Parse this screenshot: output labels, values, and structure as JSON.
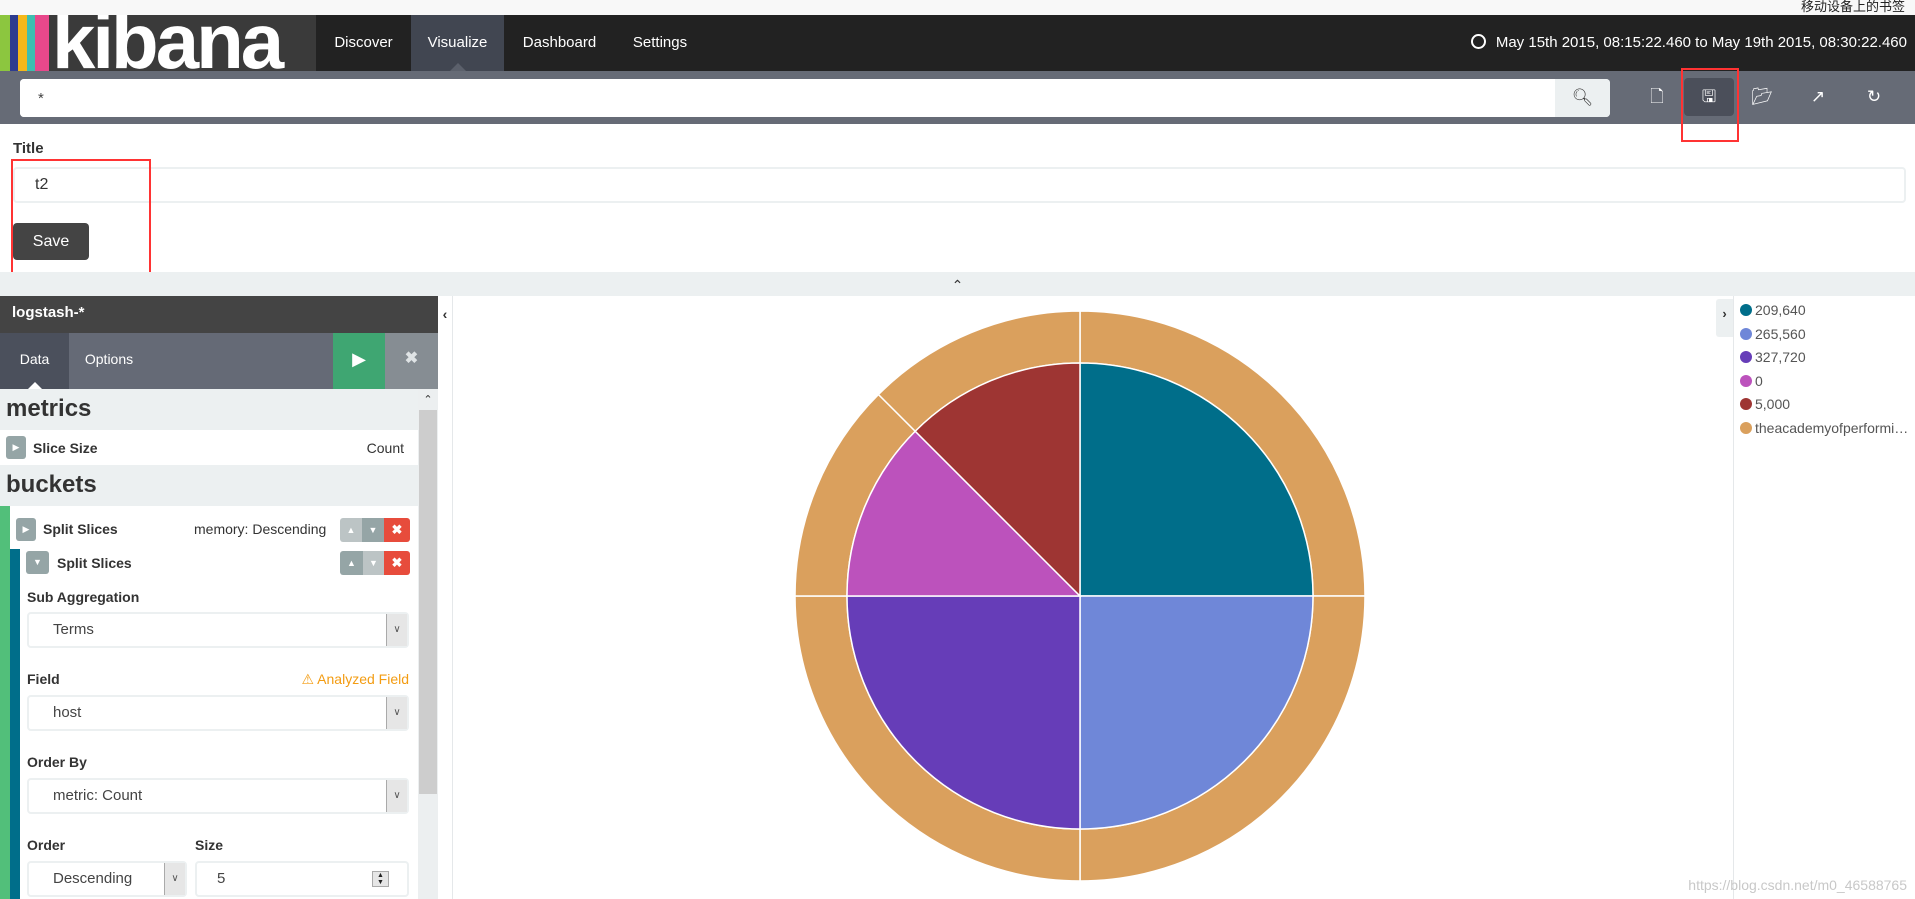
{
  "browser": {
    "bookmark_label": "移动设备上的书签"
  },
  "nav": {
    "logo": "kibana",
    "items": [
      {
        "label": "Discover"
      },
      {
        "label": "Visualize",
        "active": true
      },
      {
        "label": "Dashboard"
      },
      {
        "label": "Settings"
      }
    ],
    "time_range": "May 15th 2015, 08:15:22.460 to May 19th 2015, 08:30:22.460"
  },
  "search": {
    "query": "*"
  },
  "toolbar": {
    "icons": [
      "new-visualization-icon",
      "save-icon",
      "open-icon",
      "share-icon",
      "refresh-icon"
    ],
    "active": "save-icon"
  },
  "save_form": {
    "title_label": "Title",
    "title_value": "t2",
    "save_label": "Save"
  },
  "sidebar": {
    "index_pattern": "logstash-*",
    "tabs": [
      {
        "label": "Data",
        "active": true
      },
      {
        "label": "Options"
      }
    ],
    "metrics_heading": "metrics",
    "metric": {
      "label": "Slice Size",
      "value": "Count"
    },
    "buckets_heading": "buckets",
    "bucket1": {
      "label": "Split Slices",
      "summary": "memory: Descending"
    },
    "bucket2": {
      "label": "Split Slices",
      "sub_agg_label": "Sub Aggregation",
      "sub_agg_value": "Terms",
      "field_label": "Field",
      "field_warning": "Analyzed Field",
      "field_value": "host",
      "order_by_label": "Order By",
      "order_by_value": "metric: Count",
      "order_label": "Order",
      "order_value": "Descending",
      "size_label": "Size",
      "size_value": "5"
    }
  },
  "chart_data": {
    "type": "pie",
    "donut_rings": 2,
    "inner": {
      "labels": [
        "209,640",
        "265,560",
        "327,720",
        "0",
        "5,000"
      ],
      "values": [
        2,
        2,
        2,
        1,
        1
      ],
      "colors": [
        "#006e8a",
        "#6f87d8",
        "#663db8",
        "#bc52bc",
        "#9e3533"
      ]
    },
    "outer": {
      "labels": [
        "theacademyofperformi…",
        "theacademyofperformi…",
        "theacademyofperformi…",
        "theacademyofperformi…",
        "theacademyofperformi…"
      ],
      "values": [
        2,
        2,
        2,
        1,
        1
      ],
      "colors": [
        "#daa05d",
        "#daa05d",
        "#daa05d",
        "#daa05d",
        "#daa05d"
      ]
    },
    "legend": [
      {
        "label": "209,640",
        "color": "#006e8a"
      },
      {
        "label": "265,560",
        "color": "#6f87d8"
      },
      {
        "label": "327,720",
        "color": "#663db8"
      },
      {
        "label": "0",
        "color": "#bc52bc"
      },
      {
        "label": "5,000",
        "color": "#9e3533"
      },
      {
        "label": "theacademyofperformi…",
        "color": "#daa05d"
      }
    ],
    "legend_position": "right"
  },
  "watermark": "https://blog.csdn.net/m0_46588765",
  "colors": {
    "highlight_box": "#ff3333",
    "nav_bg": "#222222",
    "play": "#3fa672",
    "delete": "#e74c3c"
  }
}
